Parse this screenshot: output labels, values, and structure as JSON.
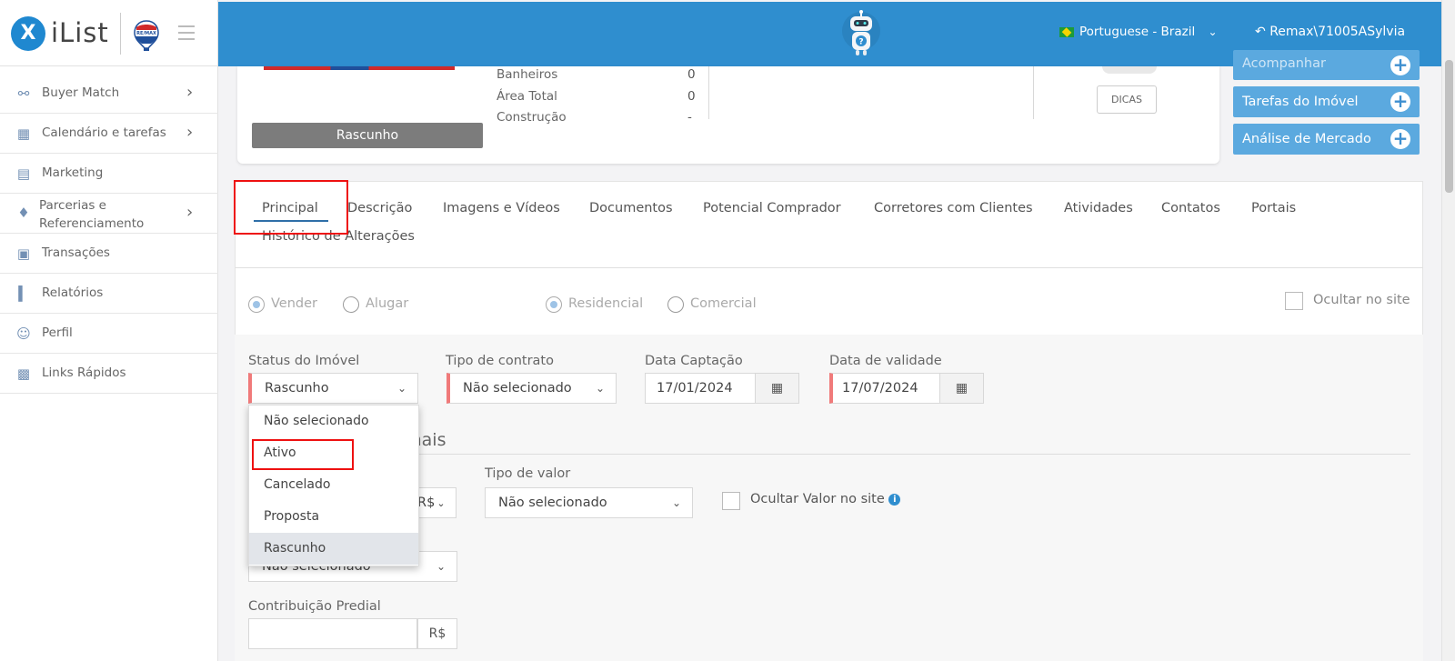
{
  "brand": {
    "name": "iList",
    "logo_mark": "X",
    "partner_logo": "RE/MAX"
  },
  "sidebar": {
    "items": [
      {
        "label": "Buyer Match",
        "icon": "handshake-icon",
        "has_submenu": true
      },
      {
        "label": "Calendário e tarefas",
        "icon": "calendar-icon",
        "has_submenu": true
      },
      {
        "label": "Marketing",
        "icon": "book-icon",
        "has_submenu": false
      },
      {
        "label": "Parcerias e Referenciamento",
        "icon": "handshake-partner-icon",
        "has_submenu": true
      },
      {
        "label": "Transações",
        "icon": "briefcase-icon",
        "has_submenu": false
      },
      {
        "label": "Relatórios",
        "icon": "bar-chart-icon",
        "has_submenu": false
      },
      {
        "label": "Perfil",
        "icon": "user-icon",
        "has_submenu": false
      },
      {
        "label": "Links Rápidos",
        "icon": "link-grid-icon",
        "has_submenu": false
      }
    ]
  },
  "topbar": {
    "language": "Portuguese - Brazil",
    "user": "Remax\\71005ASylvia",
    "robot_icon": "robot-help-icon",
    "color": "#2f8ecf"
  },
  "property": {
    "status_bar": "Rascunho",
    "specs": [
      {
        "label": "Banheiros",
        "value": "0"
      },
      {
        "label": "Área Total",
        "value": "0"
      },
      {
        "label": "Construção",
        "value": "-"
      }
    ],
    "tips_button": "DICAS"
  },
  "side_buttons": [
    {
      "label": "Acompanhar"
    },
    {
      "label": "Tarefas do Imóvel"
    },
    {
      "label": "Análise de Mercado"
    }
  ],
  "tabs": [
    {
      "label": "Principal",
      "active": true
    },
    {
      "label": "Descrição"
    },
    {
      "label": "Imagens e Vídeos"
    },
    {
      "label": "Documentos"
    },
    {
      "label": "Potencial Comprador"
    },
    {
      "label": "Corretores com Clientes"
    },
    {
      "label": "Atividades"
    },
    {
      "label": "Contatos"
    },
    {
      "label": "Portais"
    },
    {
      "label": "Histórico de Alterações"
    }
  ],
  "form": {
    "transaction": {
      "sell": "Vender",
      "rent": "Alugar",
      "selected": "Vender"
    },
    "category": {
      "residential": "Residencial",
      "commercial": "Comercial",
      "selected": "Residencial"
    },
    "hide_on_site": "Ocultar no site",
    "status": {
      "label": "Status do Imóvel",
      "value": "Rascunho"
    },
    "contract": {
      "label": "Tipo de contrato",
      "value": "Não selecionado"
    },
    "capture_date": {
      "label": "Data Captação",
      "value": "17/01/2024"
    },
    "validity_date": {
      "label": "Data de validade",
      "value": "17/07/2024"
    },
    "section_title": "onais",
    "currency_value": "R$",
    "value_type": {
      "label": "Tipo de valor",
      "value": "Não selecionado"
    },
    "hide_value": "Ocultar Valor no site",
    "partial_select": "Não selecionado",
    "building_contribution": {
      "label": "Contribuição Predial",
      "suffix": "R$"
    }
  },
  "status_dropdown": {
    "options": [
      "Não selecionado",
      "Ativo",
      "Cancelado",
      "Proposta",
      "Rascunho"
    ],
    "highlighted": "Rascunho"
  },
  "colors": {
    "accent": "#2f8ecf",
    "highlight_box": "#e11111",
    "required": "#f07a7a"
  }
}
